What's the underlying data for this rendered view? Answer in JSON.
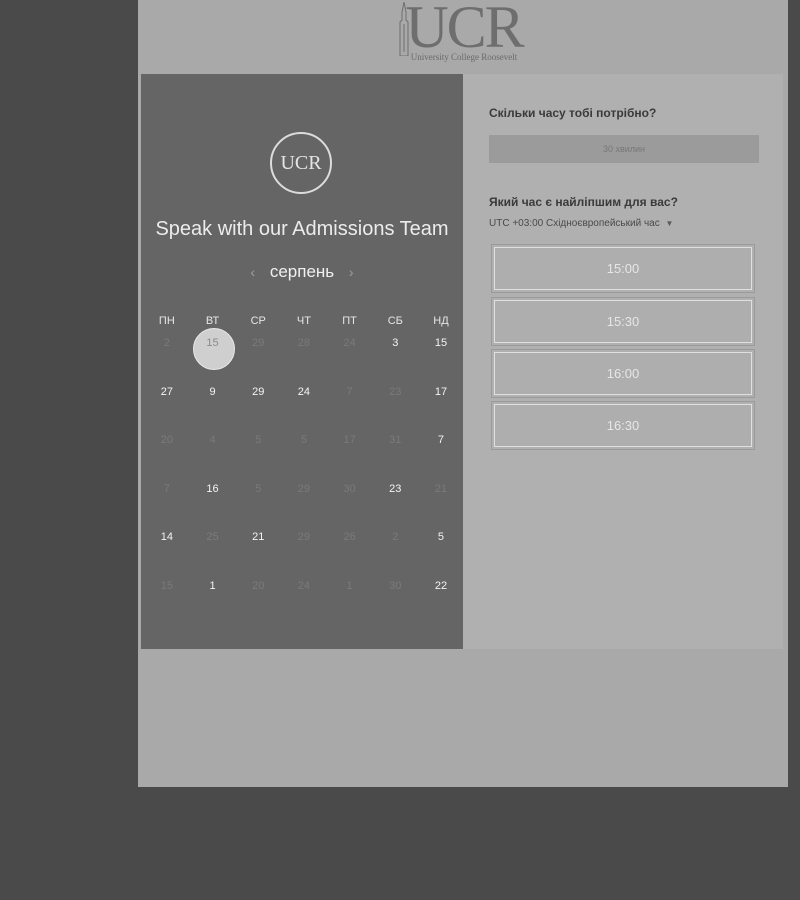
{
  "header": {
    "logo_text": "UCR",
    "logo_subtext": "University College Roosevelt"
  },
  "widget": {
    "circle_logo_text": "UCR",
    "title": "Speak with our Admissions Team",
    "month": "серпень",
    "prev_icon": "chevron-left-icon",
    "next_icon": "chevron-right-icon",
    "weekdays": [
      "ПН",
      "ВТ",
      "СР",
      "ЧТ",
      "ПТ",
      "СБ",
      "НД"
    ],
    "days": [
      {
        "n": "2",
        "active": false,
        "selected": false
      },
      {
        "n": "15",
        "active": true,
        "selected": true
      },
      {
        "n": "29",
        "active": false,
        "selected": false
      },
      {
        "n": "28",
        "active": false,
        "selected": false
      },
      {
        "n": "24",
        "active": false,
        "selected": false
      },
      {
        "n": "3",
        "active": true,
        "selected": false
      },
      {
        "n": "15",
        "active": true,
        "selected": false
      },
      {
        "n": "27",
        "active": true,
        "selected": false
      },
      {
        "n": "9",
        "active": true,
        "selected": false
      },
      {
        "n": "29",
        "active": true,
        "selected": false
      },
      {
        "n": "24",
        "active": true,
        "selected": false
      },
      {
        "n": "7",
        "active": false,
        "selected": false
      },
      {
        "n": "23",
        "active": false,
        "selected": false
      },
      {
        "n": "17",
        "active": true,
        "selected": false
      },
      {
        "n": "20",
        "active": false,
        "selected": false
      },
      {
        "n": "4",
        "active": false,
        "selected": false
      },
      {
        "n": "5",
        "active": false,
        "selected": false
      },
      {
        "n": "5",
        "active": false,
        "selected": false
      },
      {
        "n": "17",
        "active": false,
        "selected": false
      },
      {
        "n": "31",
        "active": false,
        "selected": false
      },
      {
        "n": "7",
        "active": true,
        "selected": false
      },
      {
        "n": "7",
        "active": false,
        "selected": false
      },
      {
        "n": "16",
        "active": true,
        "selected": false
      },
      {
        "n": "5",
        "active": false,
        "selected": false
      },
      {
        "n": "29",
        "active": false,
        "selected": false
      },
      {
        "n": "30",
        "active": false,
        "selected": false
      },
      {
        "n": "23",
        "active": true,
        "selected": false
      },
      {
        "n": "21",
        "active": false,
        "selected": false
      },
      {
        "n": "14",
        "active": true,
        "selected": false
      },
      {
        "n": "25",
        "active": false,
        "selected": false
      },
      {
        "n": "21",
        "active": true,
        "selected": false
      },
      {
        "n": "29",
        "active": false,
        "selected": false
      },
      {
        "n": "26",
        "active": false,
        "selected": false
      },
      {
        "n": "2",
        "active": false,
        "selected": false
      },
      {
        "n": "5",
        "active": true,
        "selected": false
      },
      {
        "n": "15",
        "active": false,
        "selected": false
      },
      {
        "n": "1",
        "active": true,
        "selected": false
      },
      {
        "n": "20",
        "active": false,
        "selected": false
      },
      {
        "n": "24",
        "active": false,
        "selected": false
      },
      {
        "n": "1",
        "active": false,
        "selected": false
      },
      {
        "n": "30",
        "active": false,
        "selected": false
      },
      {
        "n": "22",
        "active": true,
        "selected": false
      }
    ],
    "duration_question": "Скільки часу тобі потрібно?",
    "duration_value": "30 хвилин",
    "time_question": "Який час є найліпшим для вас?",
    "timezone": "UTC +03:00 Східноєвропейський час",
    "timezone_icon": "caret-down-icon",
    "time_slots": [
      "15:00",
      "15:30",
      "16:00",
      "16:30"
    ]
  }
}
